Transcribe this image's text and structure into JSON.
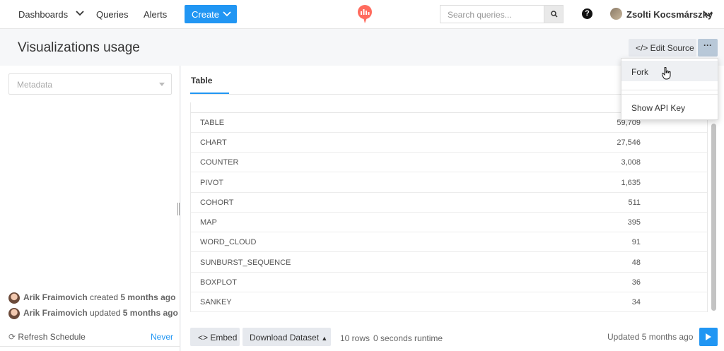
{
  "nav": {
    "dashboards": "Dashboards",
    "queries": "Queries",
    "alerts": "Alerts",
    "create": "Create",
    "search_placeholder": "Search queries...",
    "help": "?",
    "user_name": "Zsolti Kocsmárszky"
  },
  "header": {
    "title": "Visualizations usage",
    "edit_source": "</> Edit Source",
    "more": "···"
  },
  "dropdown": {
    "fork": "Fork",
    "show_api_key": "Show API Key"
  },
  "schema": {
    "placeholder": "Metadata"
  },
  "query_info": {
    "created_by": "Arik Fraimovich",
    "created_label": "created",
    "created_time": "5 months ago",
    "updated_by": "Arik Fraimovich",
    "updated_label": "updated",
    "updated_time": "5 months ago",
    "refresh_label": "Refresh Schedule",
    "refresh_value": "Never"
  },
  "tabs": {
    "table": "Table"
  },
  "table": {
    "rows": [
      {
        "type": "TABLE",
        "count": "59,709"
      },
      {
        "type": "CHART",
        "count": "27,546"
      },
      {
        "type": "COUNTER",
        "count": "3,008"
      },
      {
        "type": "PIVOT",
        "count": "1,635"
      },
      {
        "type": "COHORT",
        "count": "511"
      },
      {
        "type": "MAP",
        "count": "395"
      },
      {
        "type": "WORD_CLOUD",
        "count": "91"
      },
      {
        "type": "SUNBURST_SEQUENCE",
        "count": "48"
      },
      {
        "type": "BOXPLOT",
        "count": "36"
      },
      {
        "type": "SANKEY",
        "count": "34"
      }
    ]
  },
  "footer": {
    "embed": "<> Embed",
    "download": "Download Dataset",
    "rows": "10 rows",
    "runtime": "0 seconds runtime",
    "updated": "Updated 5 months ago"
  },
  "colors": {
    "accent": "#2196f3",
    "logo": "#ff6b5e"
  }
}
